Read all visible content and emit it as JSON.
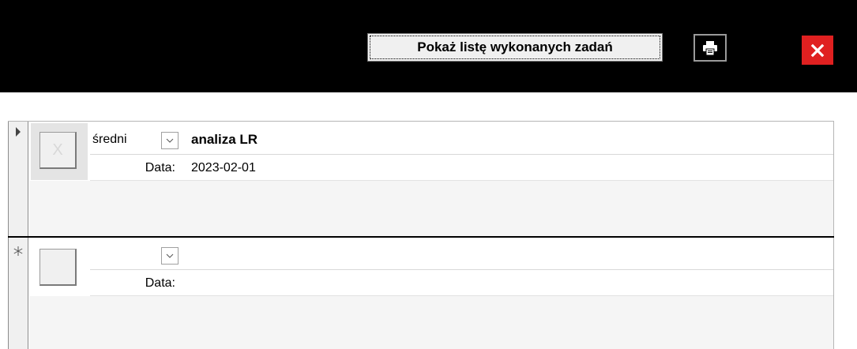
{
  "toolbar": {
    "show_completed_label": "Pokaż listę wykonanych zadań",
    "print_icon": "printer-icon",
    "close_icon": "close-icon",
    "close_color": "#e02020"
  },
  "records": [
    {
      "priority": "średni",
      "task": "analiza LR",
      "date_label": "Data:",
      "date": "2023-02-01",
      "checkbox_glyph": "X"
    },
    {
      "priority": "",
      "task": "",
      "date_label": "Data:",
      "date": ""
    }
  ]
}
